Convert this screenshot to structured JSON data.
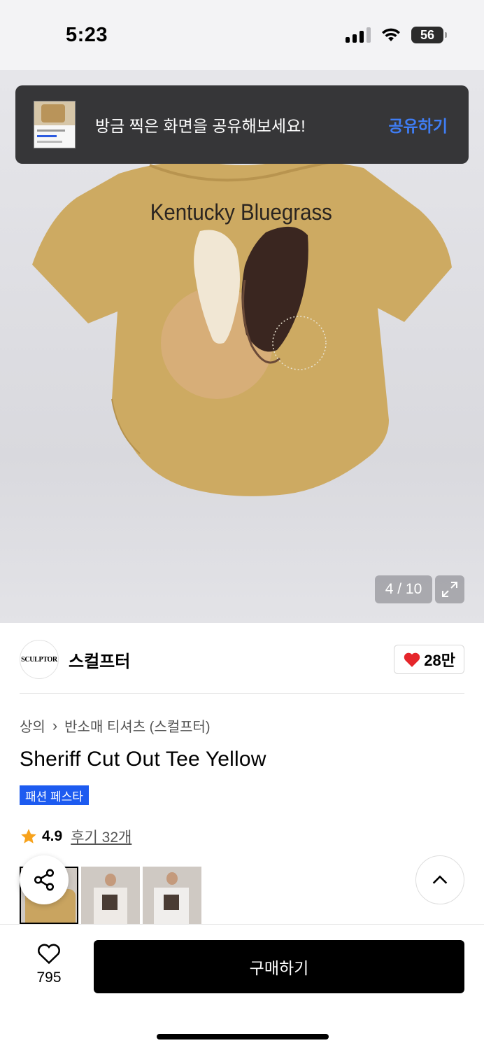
{
  "status_bar": {
    "time": "5:23",
    "battery": "56"
  },
  "toast": {
    "message": "방금 찍은 화면을 공유해보세요!",
    "action": "공유하기"
  },
  "hero": {
    "print_text": "Kentucky Bluegrass",
    "counter": "4 / 10",
    "shirt_color": "#cdaa62"
  },
  "brand": {
    "logo_text": "SCULPTOR",
    "name": "스컬프터",
    "likes": "28만"
  },
  "breadcrumb": {
    "category": "상의",
    "separator": "›",
    "subcategory": "반소매 티셔츠 (스컬프터)"
  },
  "product": {
    "title": "Sheriff Cut Out Tee Yellow",
    "event_badge": "패션 페스타"
  },
  "rating": {
    "value": "4.9",
    "reviews": "후기 32개"
  },
  "bottom_bar": {
    "wish_count": "795",
    "buy_label": "구매하기"
  },
  "colors": {
    "accent_blue": "#1d5bf0",
    "link_blue": "#3f7df4",
    "heart_red": "#e5262b"
  }
}
